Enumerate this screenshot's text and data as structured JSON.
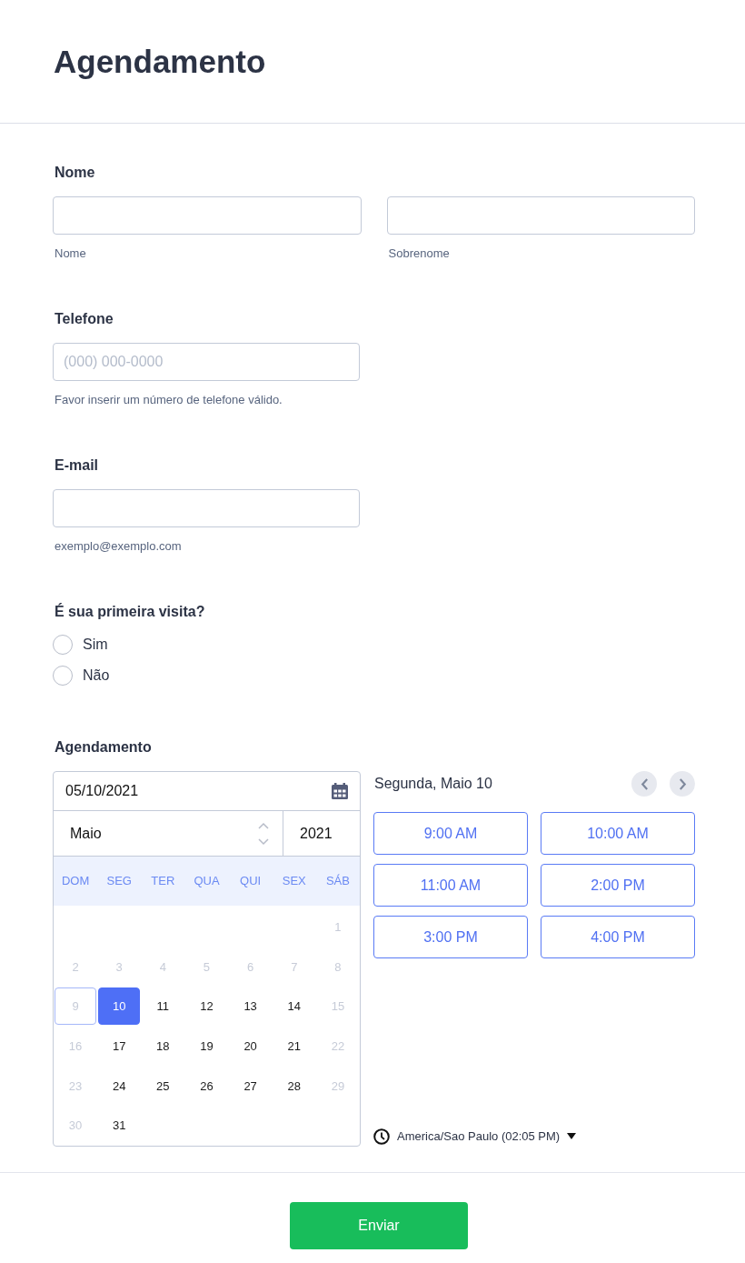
{
  "header": {
    "title": "Agendamento"
  },
  "name_field": {
    "label": "Nome",
    "inputs": [
      {
        "sublabel": "Nome"
      },
      {
        "sublabel": "Sobrenome"
      }
    ]
  },
  "phone_field": {
    "label": "Telefone",
    "placeholder": "(000) 000-0000",
    "sublabel": "Favor inserir um número de telefone válido."
  },
  "email_field": {
    "label": "E-mail",
    "sublabel": "exemplo@exemplo.com"
  },
  "first_visit": {
    "label": "É sua primeira visita?",
    "options": [
      {
        "label": "Sim",
        "selected": false
      },
      {
        "label": "Não",
        "selected": false
      }
    ]
  },
  "appointment": {
    "label": "Agendamento",
    "date": "05/10/2021",
    "month": "Maio",
    "year": "2021",
    "weekdays": [
      "DOM",
      "SEG",
      "TER",
      "QUA",
      "QUI",
      "SEX",
      "SÁB"
    ],
    "weeks": [
      {
        "days": [
          {
            "label": "1",
            "disabled": true,
            "selected": false,
            "today": false
          }
        ]
      },
      {
        "days": [
          {
            "label": "2",
            "disabled": true,
            "selected": false,
            "today": false
          },
          {
            "label": "3",
            "disabled": true,
            "selected": false,
            "today": false
          },
          {
            "label": "4",
            "disabled": true,
            "selected": false,
            "today": false
          },
          {
            "label": "5",
            "disabled": true,
            "selected": false,
            "today": false
          },
          {
            "label": "6",
            "disabled": true,
            "selected": false,
            "today": false
          },
          {
            "label": "7",
            "disabled": true,
            "selected": false,
            "today": false
          },
          {
            "label": "8",
            "disabled": true,
            "selected": false,
            "today": false
          }
        ]
      },
      {
        "days": [
          {
            "label": "9",
            "disabled": true,
            "selected": false,
            "today": true
          },
          {
            "label": "10",
            "disabled": false,
            "selected": true,
            "today": false
          },
          {
            "label": "11",
            "disabled": false,
            "selected": false,
            "today": false
          },
          {
            "label": "12",
            "disabled": false,
            "selected": false,
            "today": false
          },
          {
            "label": "13",
            "disabled": false,
            "selected": false,
            "today": false
          },
          {
            "label": "14",
            "disabled": false,
            "selected": false,
            "today": false
          },
          {
            "label": "15",
            "disabled": true,
            "selected": false,
            "today": false
          }
        ]
      },
      {
        "days": [
          {
            "label": "16",
            "disabled": true,
            "selected": false,
            "today": false
          },
          {
            "label": "17",
            "disabled": false,
            "selected": false,
            "today": false
          },
          {
            "label": "18",
            "disabled": false,
            "selected": false,
            "today": false
          },
          {
            "label": "19",
            "disabled": false,
            "selected": false,
            "today": false
          },
          {
            "label": "20",
            "disabled": false,
            "selected": false,
            "today": false
          },
          {
            "label": "21",
            "disabled": false,
            "selected": false,
            "today": false
          },
          {
            "label": "22",
            "disabled": true,
            "selected": false,
            "today": false
          }
        ]
      },
      {
        "days": [
          {
            "label": "23",
            "disabled": true,
            "selected": false,
            "today": false
          },
          {
            "label": "24",
            "disabled": false,
            "selected": false,
            "today": false
          },
          {
            "label": "25",
            "disabled": false,
            "selected": false,
            "today": false
          },
          {
            "label": "26",
            "disabled": false,
            "selected": false,
            "today": false
          },
          {
            "label": "27",
            "disabled": false,
            "selected": false,
            "today": false
          },
          {
            "label": "28",
            "disabled": false,
            "selected": false,
            "today": false
          },
          {
            "label": "29",
            "disabled": true,
            "selected": false,
            "today": false
          }
        ]
      },
      {
        "days": [
          {
            "label": "30",
            "disabled": true,
            "selected": false,
            "today": false
          },
          {
            "label": "31",
            "disabled": false,
            "selected": false,
            "today": false
          }
        ]
      }
    ],
    "day_heading": "Segunda, Maio 10",
    "slots": [
      {
        "label": "9:00 AM",
        "selected": false
      },
      {
        "label": "10:00 AM",
        "selected": false
      },
      {
        "label": "11:00 AM",
        "selected": false
      },
      {
        "label": "2:00 PM",
        "selected": false
      },
      {
        "label": "3:00 PM",
        "selected": false
      },
      {
        "label": "4:00 PM",
        "selected": false
      }
    ],
    "timezone": "America/Sao Paulo (02:05 PM)"
  },
  "submit_button": "Enviar"
}
